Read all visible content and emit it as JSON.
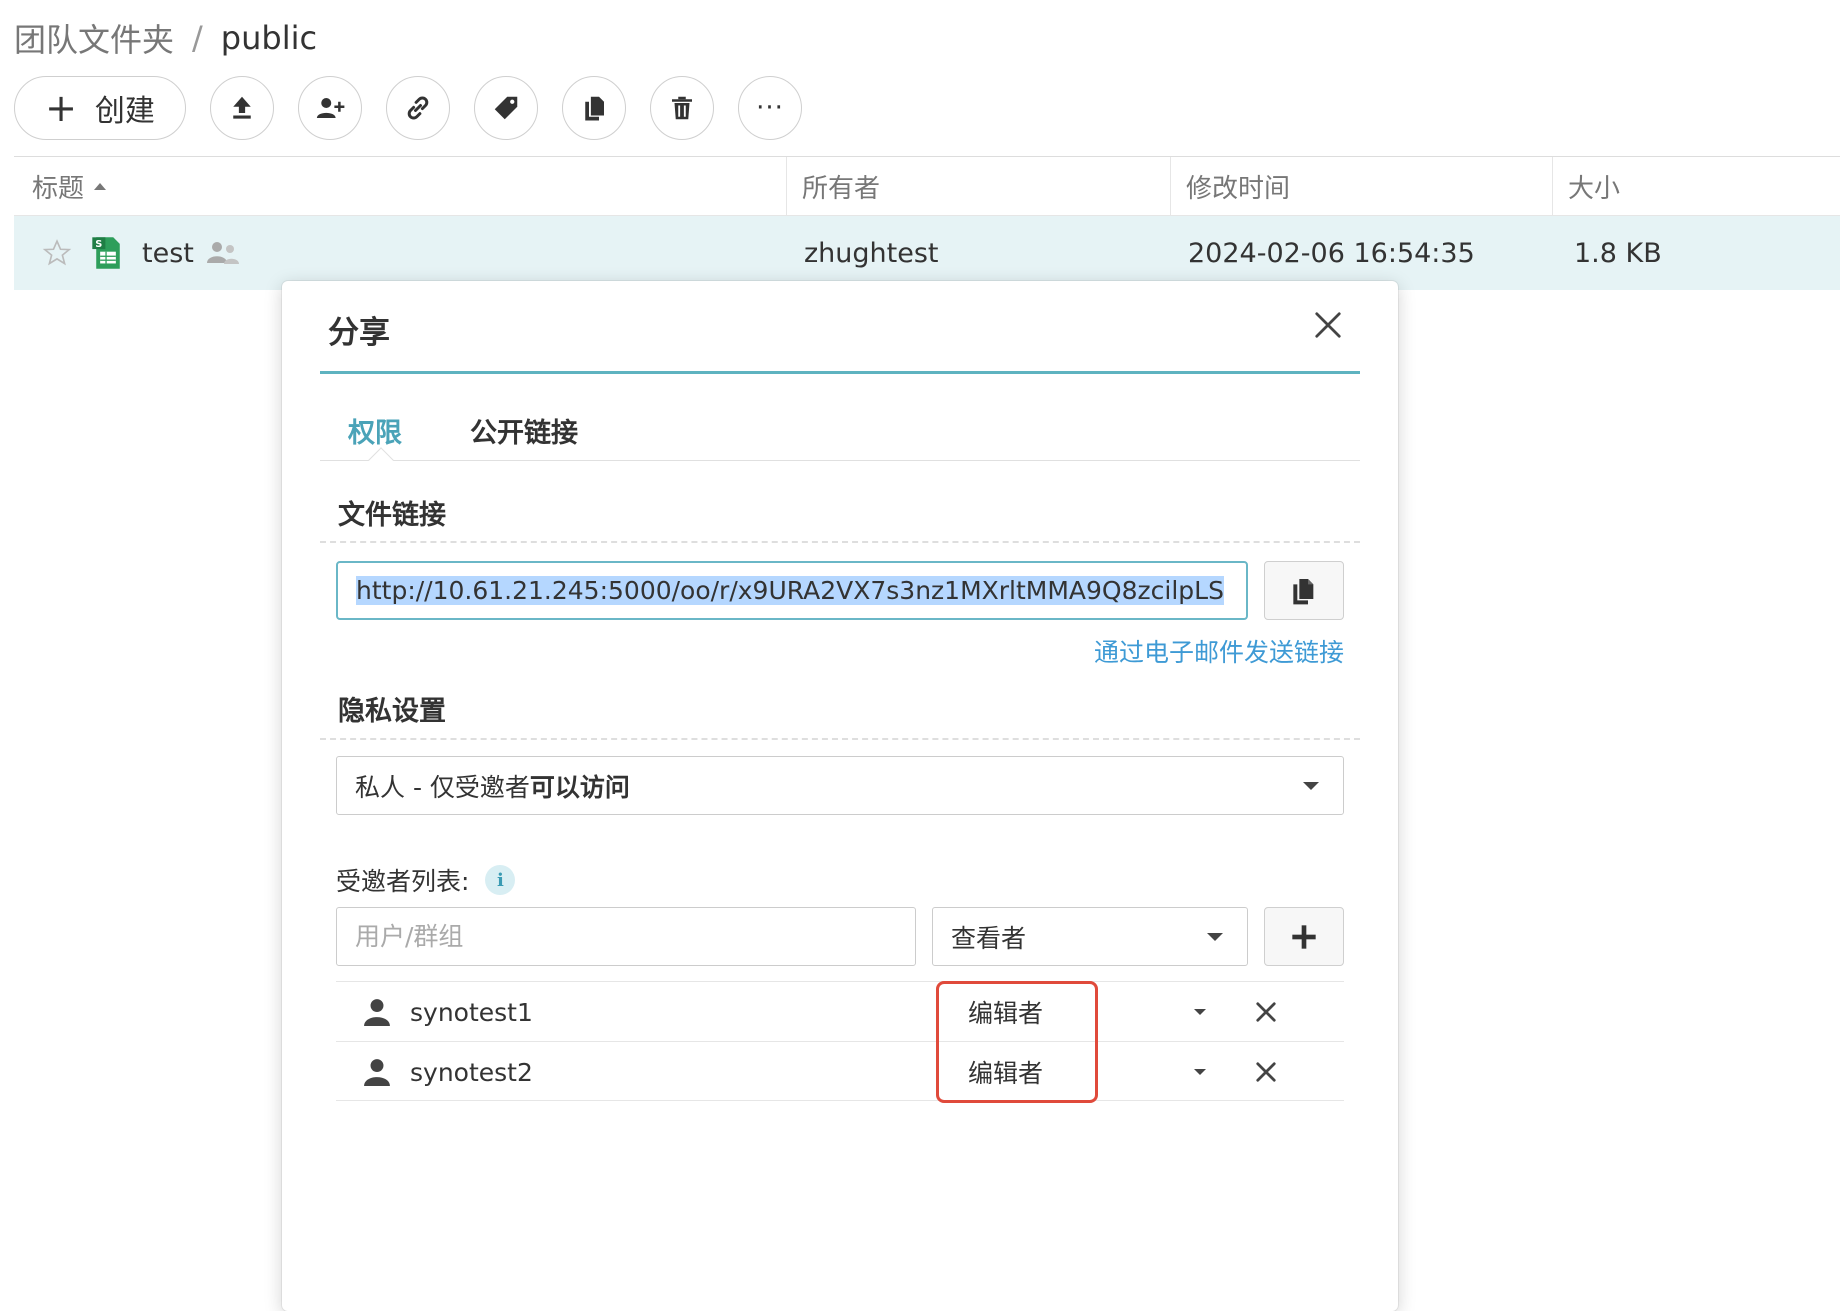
{
  "breadcrumb": {
    "root": "团队文件夹",
    "separator": "/",
    "current": "public"
  },
  "toolbar": {
    "create_label": "创建",
    "buttons": [
      "upload-icon",
      "add-user-icon",
      "link-icon",
      "tag-icon",
      "copy-icon",
      "trash-icon",
      "more-icon"
    ],
    "more_label": "···"
  },
  "table": {
    "headers": {
      "title": "标题",
      "owner": "所有者",
      "modified": "修改时间",
      "size": "大小"
    },
    "rows": [
      {
        "name": "test",
        "owner": "zhughtest",
        "modified": "2024-02-06 16:54:35",
        "size": "1.8 KB",
        "file_badge": "S"
      }
    ]
  },
  "dialog": {
    "title": "分享",
    "tabs": [
      "权限",
      "公开链接"
    ],
    "active_tab": 0,
    "file_link": {
      "section_title": "文件链接",
      "url": "http://10.61.21.245:5000/oo/r/x9URA2VX7s3nz1MXrltMMA9Q8zcilpLS",
      "email_link": "通过电子邮件发送链接"
    },
    "privacy": {
      "section_title": "隐私设置",
      "prefix": "私人 - 仅受邀者",
      "bold_part": "可以访问"
    },
    "invitees": {
      "label": "受邀者列表:",
      "info": "i",
      "input_placeholder": "用户/群组",
      "default_role": "查看者",
      "list": [
        {
          "name": "synotest1",
          "role": "编辑者"
        },
        {
          "name": "synotest2",
          "role": "编辑者"
        }
      ]
    }
  },
  "colors": {
    "accent": "#5eb3c0",
    "tab_active": "#4aa3b8",
    "link": "#3e9ad5",
    "row_highlight": "#e6f3f5",
    "annotation": "#e04a3b"
  }
}
